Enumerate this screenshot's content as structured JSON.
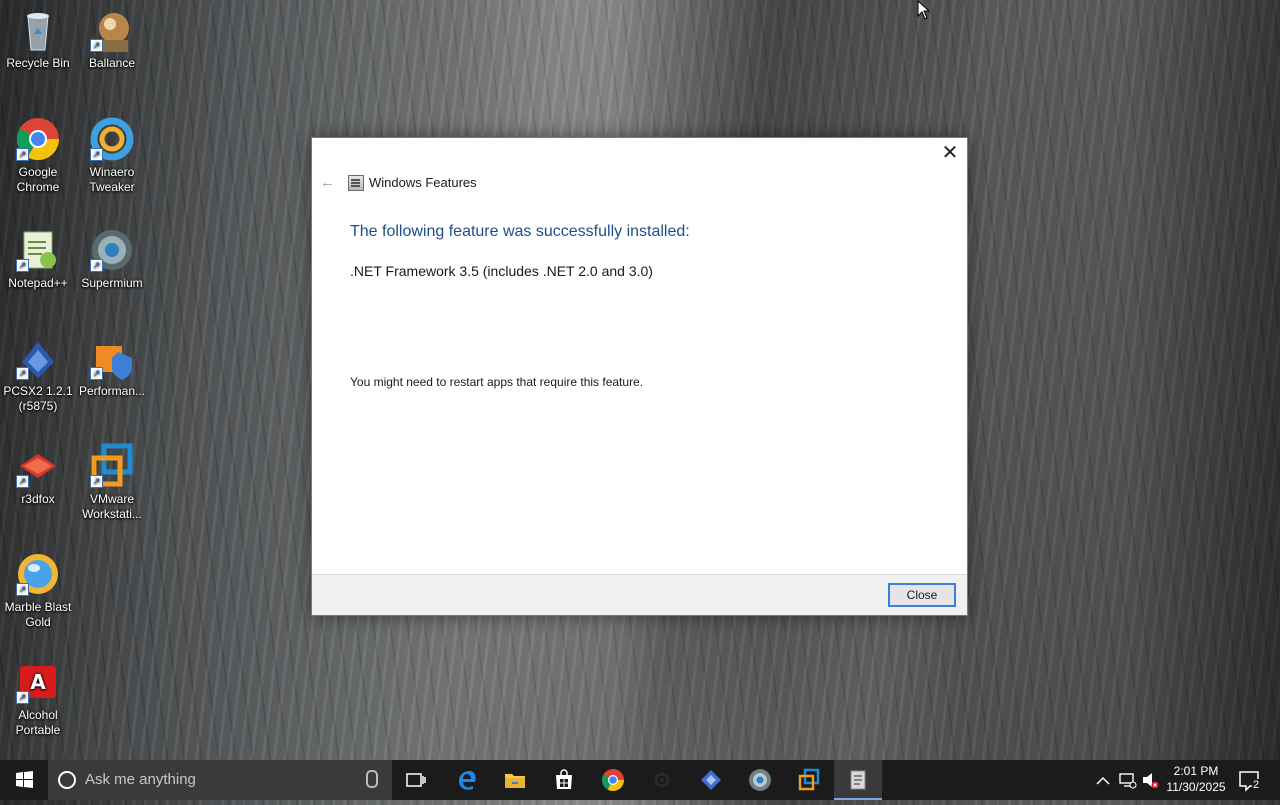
{
  "desktop": {
    "icons": [
      {
        "label": "Recycle Bin",
        "name": "recycle-bin"
      },
      {
        "label": "Ballance",
        "name": "ballance"
      },
      {
        "label": "Google Chrome",
        "name": "google-chrome"
      },
      {
        "label": "Winaero Tweaker",
        "name": "winaero-tweaker"
      },
      {
        "label": "Notepad++",
        "name": "notepad-plus-plus"
      },
      {
        "label": "Supermium",
        "name": "supermium"
      },
      {
        "label": "PCSX2 1.2.1 (r5875)",
        "name": "pcsx2"
      },
      {
        "label": "Performan...",
        "name": "performance"
      },
      {
        "label": "r3dfox",
        "name": "r3dfox"
      },
      {
        "label": "VMware Workstati...",
        "name": "vmware-workstation"
      },
      {
        "label": "Marble Blast Gold",
        "name": "marble-blast-gold"
      },
      {
        "label": "Alcohol Portable",
        "name": "alcohol-portable"
      }
    ]
  },
  "dialog": {
    "title": "Windows Features",
    "heading": "The following feature was successfully installed:",
    "feature": ".NET Framework 3.5 (includes .NET 2.0 and 3.0)",
    "note": "You might need to restart apps that require this feature.",
    "close_button": "Close",
    "close_glyph": "✕",
    "back_glyph": "←"
  },
  "taskbar": {
    "search_placeholder": "Ask me anything",
    "apps": [
      "task-view",
      "edge",
      "file-explorer",
      "store",
      "chrome",
      "settings",
      "pcsx2",
      "supermium",
      "vmware",
      "windows-features"
    ],
    "clock": {
      "time": "2:01 PM",
      "date": "11/30/2025"
    },
    "notification_count": "2"
  },
  "colors": {
    "heading": "#1e4f8c",
    "taskbar": "#1b1b1b",
    "button_border": "#3c7fd6"
  }
}
